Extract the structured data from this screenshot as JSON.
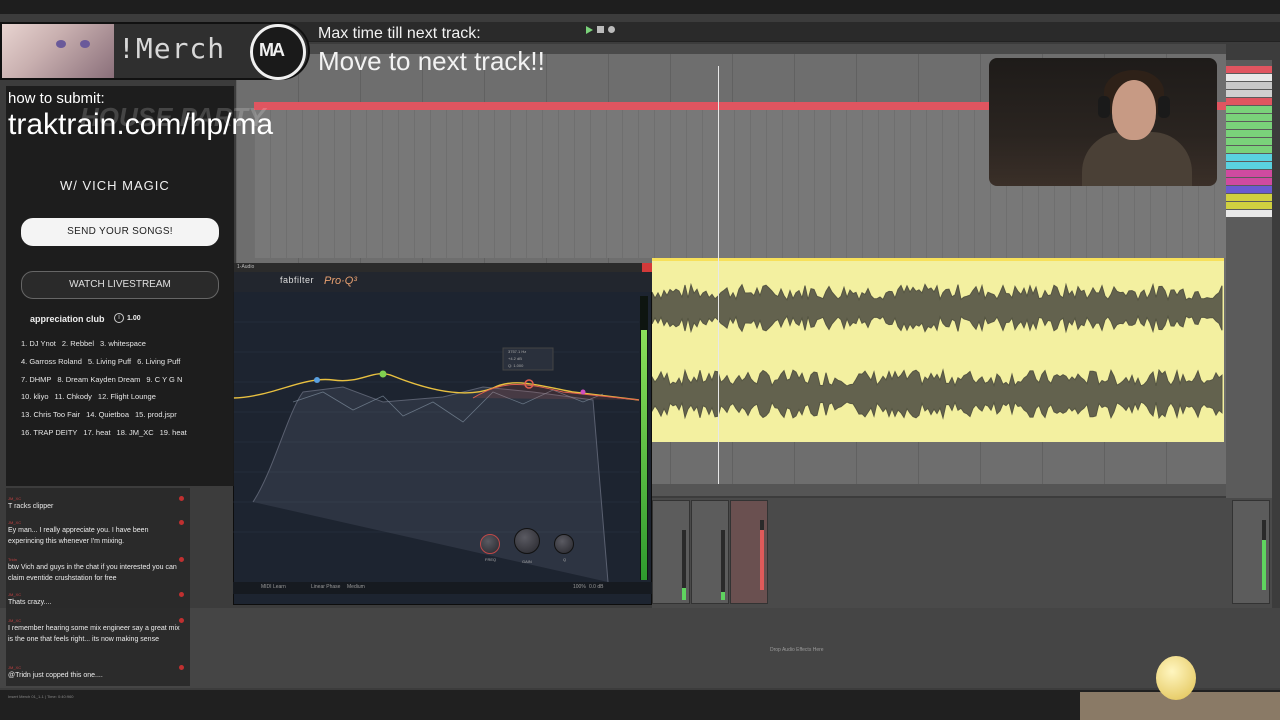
{
  "overlay": {
    "merch_label": "!Merch",
    "logo_label": "MA",
    "max_time_label": "Max time till next track:",
    "max_time_value": "Move to next track!!",
    "submit_label": "how to submit:",
    "submit_url": "traktrain.com/hp/ma",
    "with_line": "W/  VICH MAGIC",
    "send_button": "SEND YOUR SONGS!",
    "watch_button": "WATCH LIVESTREAM",
    "club_title": "appreciation club",
    "club_info_icon": "i",
    "club_value": "1.00",
    "club_rows": [
      [
        "1. DJ Ynot",
        "2. Rebbel",
        "3. whitespace"
      ],
      [
        "4. Garross Roland",
        "5. Living Puff",
        "6. Living Puff"
      ],
      [
        "7. DHMP",
        "8. Dream Kayden Dream",
        "9. C Y G N"
      ],
      [
        "10. kliyo",
        "11. Chkody",
        "12. Flight Lounge"
      ],
      [
        "13. Chris Too Fair",
        "14. Quietboa",
        "15. prod.jspr"
      ],
      [
        "16. TRAP DEITY",
        "17. heat",
        "18. JM_XC",
        "19. heat"
      ]
    ]
  },
  "chat": {
    "messages": [
      {
        "user": "JM_XC",
        "text": "T racks clipper"
      },
      {
        "user": "JM_XC",
        "text": "Ey man... I really appreciate you. I have been experincing this whenever I'm mixing."
      },
      {
        "user": "Tridn",
        "text": "btw Vich and guys in the chat if you interested you can claim eventide crushstation for free"
      },
      {
        "user": "JM_XC",
        "text": "Thats crazy...."
      },
      {
        "user": "JM_XC",
        "text": "I remember hearing some mix engineer say a great mix is the one that feels right... its now making sense"
      },
      {
        "user": "JM_XC",
        "text": "@Tridn just copped this one...."
      }
    ]
  },
  "plugin": {
    "title": "1-Audio",
    "brand": "fabfilter",
    "product": "Pro·Q³",
    "footer": {
      "midi_learn": "MIDI Learn",
      "phase": "Linear Phase",
      "quality": "Medium",
      "zoom": "100%",
      "gain": "0.0 dB"
    },
    "knobs": {
      "freq": "FREQ",
      "gain": "GAIN",
      "q": "Q"
    },
    "band_readout": [
      "3757.1 Hz",
      "+4.2 dB",
      "Q: 1.000"
    ]
  },
  "daw": {
    "drop_text": "Drop Audio Effects Here",
    "status_text": "Insert Merch 01_1-1 | Time: 0:40:960",
    "colors": {
      "red_clip": "#e05560",
      "yellow_clip": "#f3f0a0",
      "track_strip": [
        "#e05560",
        "#e8e8e8",
        "#c8c8c8",
        "#d0d0d0",
        "#e05560",
        "#7ad27a",
        "#7ad27a",
        "#7ad27a",
        "#7ad27a",
        "#7ad27a",
        "#7ad27a",
        "#5ad2e0",
        "#5ad2e0",
        "#d04aa0",
        "#d04aa0",
        "#6a5ad2",
        "#d0d040",
        "#d0d040",
        "#e8e8e8"
      ]
    }
  }
}
